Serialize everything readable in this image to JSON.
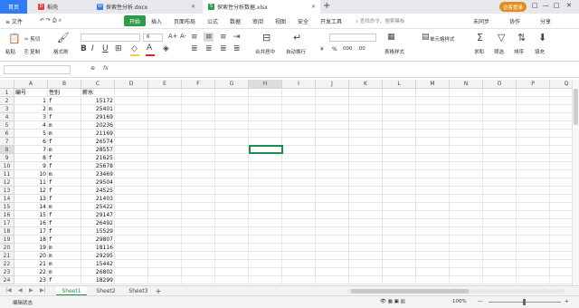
{
  "titlebar": {
    "tabs": [
      {
        "label": "首页",
        "icon": "home"
      },
      {
        "label": "稻壳",
        "icon": "docer-icon"
      },
      {
        "label": "探索性分析.docx",
        "icon": "word-icon"
      },
      {
        "label": "探索性分析数据.xlsx",
        "icon": "excel-icon"
      }
    ],
    "add_tab": "+",
    "right_button": "访客登录",
    "window_controls": [
      "□",
      "—",
      "□",
      "✕"
    ]
  },
  "menubar": {
    "file": "≡ 文件",
    "items": [
      "开始",
      "插入",
      "页面布局",
      "公式",
      "数据",
      "审阅",
      "视图",
      "安全",
      "开发工具"
    ],
    "search_placeholder": "查找命令、搜索模板",
    "right": [
      "未同步",
      "协作",
      "分享"
    ]
  },
  "ribbon": {
    "clipboard": {
      "paste": "粘贴",
      "cut": "剪切",
      "copy": "复制",
      "format_painter": "格式刷"
    },
    "font_name": "",
    "font_size": "6",
    "font_buttons": [
      "B",
      "I",
      "U",
      "A+",
      "A-"
    ],
    "merge": "合并居中",
    "wrap": "自动换行",
    "number_format": "",
    "percent": "%",
    "table_style": "表格样式",
    "cond_format": "单元格样式",
    "sum": "求和",
    "filter": "筛选",
    "sort": "排序",
    "fill": "填充",
    "colors": {
      "font_red": "#e02020",
      "fill_yellow": "#f6d23e",
      "accent_green": "#2e9b48",
      "blue": "#2e7df6"
    }
  },
  "formula_bar": {
    "name_box": "",
    "fx": "fx"
  },
  "columns": [
    "A",
    "B",
    "C",
    "D",
    "E",
    "F",
    "G",
    "H",
    "I",
    "J",
    "K",
    "L",
    "M",
    "N",
    "O",
    "P",
    "Q"
  ],
  "selected_column": "H",
  "selected_row": 8,
  "header_row": [
    "编号",
    "性别",
    "薪水"
  ],
  "rows": [
    {
      "id": 1,
      "sex": "f",
      "salary": 15172
    },
    {
      "id": 2,
      "sex": "m",
      "salary": 25401
    },
    {
      "id": 3,
      "sex": "f",
      "salary": 29169
    },
    {
      "id": 4,
      "sex": "m",
      "salary": 20236
    },
    {
      "id": 5,
      "sex": "m",
      "salary": 21169
    },
    {
      "id": 6,
      "sex": "f",
      "salary": 26574
    },
    {
      "id": 7,
      "sex": "m",
      "salary": 28557
    },
    {
      "id": 8,
      "sex": "f",
      "salary": 21625
    },
    {
      "id": 9,
      "sex": "f",
      "salary": 25678
    },
    {
      "id": 10,
      "sex": "m",
      "salary": 23469
    },
    {
      "id": 11,
      "sex": "f",
      "salary": 29504
    },
    {
      "id": 12,
      "sex": "f",
      "salary": 24525
    },
    {
      "id": 13,
      "sex": "f",
      "salary": 21403
    },
    {
      "id": 14,
      "sex": "m",
      "salary": 25422
    },
    {
      "id": 15,
      "sex": "f",
      "salary": 29147
    },
    {
      "id": 16,
      "sex": "f",
      "salary": 26492
    },
    {
      "id": 17,
      "sex": "f",
      "salary": 15529
    },
    {
      "id": 18,
      "sex": "f",
      "salary": 29807
    },
    {
      "id": 19,
      "sex": "m",
      "salary": 18116
    },
    {
      "id": 20,
      "sex": "m",
      "salary": 29295
    },
    {
      "id": 21,
      "sex": "m",
      "salary": 15442
    },
    {
      "id": 22,
      "sex": "m",
      "salary": 26802
    },
    {
      "id": 23,
      "sex": "f",
      "salary": 18299
    }
  ],
  "sheets": [
    "Sheet1",
    "Sheet2",
    "Sheet3"
  ],
  "active_sheet": "Sheet1",
  "add_sheet": "+",
  "status": {
    "mode": "编辑状态",
    "zoom": "100%",
    "zoom_minus": "—",
    "zoom_plus": "+"
  }
}
